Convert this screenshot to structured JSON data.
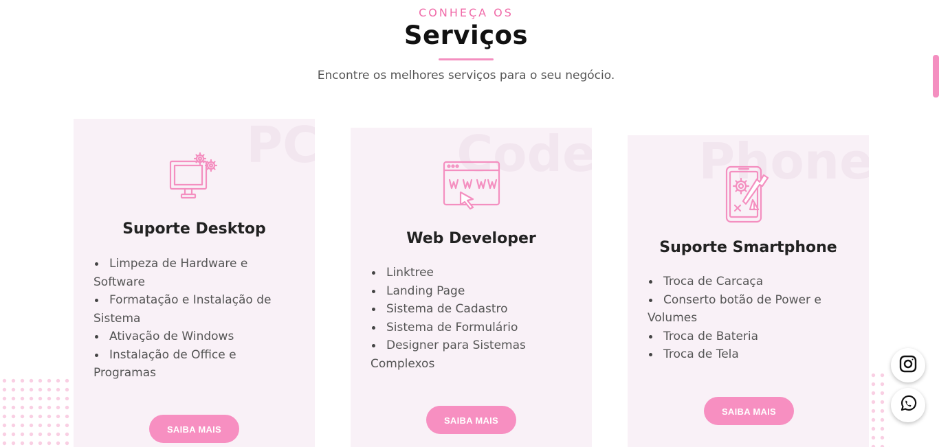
{
  "section": {
    "eyebrow": "CONHEÇA OS",
    "title": "Serviços",
    "subtitle": "Encontre os melhores serviços para o seu negócio."
  },
  "cards": [
    {
      "watermark": "PC",
      "icon": "desktop-gears-icon",
      "title": "Suporte Desktop",
      "items": [
        "Limpeza de Hardware e Software",
        "Formatação e Instalação de Sistema",
        "Ativação de Windows",
        "Instalação de Office e Programas"
      ],
      "button": "SAIBA MAIS"
    },
    {
      "watermark": "Code",
      "icon": "www-browser-icon",
      "title": "Web Developer",
      "items": [
        "Linktree",
        "Landing Page",
        "Sistema de Cadastro",
        "Sistema de Formulário",
        "Designer para Sistemas Complexos"
      ],
      "button": "SAIBA MAIS"
    },
    {
      "watermark": "Phone",
      "icon": "smartphone-repair-icon",
      "title": "Suporte Smartphone",
      "items": [
        "Troca de Carcaça",
        "Conserto botão de Power e Volumes",
        "Troca de Bateria",
        "Troca de Tela"
      ],
      "button": "SAIBA MAIS"
    }
  ],
  "floating": {
    "instagram_icon": "instagram-icon",
    "whatsapp_icon": "whatsapp-icon"
  },
  "colors": {
    "accent": "#f48fc0",
    "button": "#f78fc1",
    "card_bg": "#f9f1f7",
    "eyebrow": "#f06aa8"
  }
}
